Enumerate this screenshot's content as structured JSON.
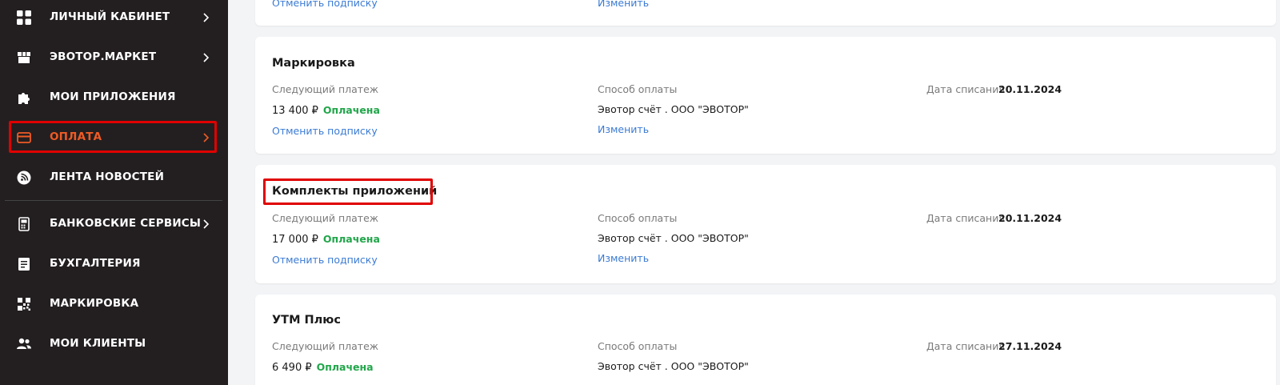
{
  "sidebar": {
    "items": [
      {
        "label": "ЛИЧНЫЙ КАБИНЕТ",
        "icon": "grid-icon",
        "chevron": true
      },
      {
        "label": "ЭВОТОР.МАРКЕТ",
        "icon": "store-icon",
        "chevron": true
      },
      {
        "label": "МОИ ПРИЛОЖЕНИЯ",
        "icon": "puzzle-icon",
        "chevron": false
      },
      {
        "label": "ОПЛАТА",
        "icon": "card-icon",
        "chevron": true,
        "active": true
      },
      {
        "label": "ЛЕНТА НОВОСТЕЙ",
        "icon": "feed-icon",
        "chevron": false
      },
      {
        "label": "БАНКОВСКИЕ СЕРВИСЫ",
        "icon": "bank-terminal-icon",
        "chevron": true
      },
      {
        "label": "БУХГАЛТЕРИЯ",
        "icon": "receipt-icon",
        "chevron": false
      },
      {
        "label": "МАРКИРОВКА",
        "icon": "qr-code-icon",
        "chevron": false
      },
      {
        "label": "МОИ КЛИЕНТЫ",
        "icon": "users-icon",
        "chevron": false
      }
    ],
    "colors": {
      "background": "#231f20",
      "active": "#ef5b25",
      "highlight": "#e00000"
    }
  },
  "top_card": {
    "cancel_link": "Отменить подписку",
    "change_link": "Изменить"
  },
  "cards": [
    {
      "title": "Маркировка",
      "next_payment_label": "Следующий платеж",
      "amount": "13 400 ₽",
      "status": "Оплачена",
      "method_label": "Способ оплаты",
      "method": "Эвотор счёт . ООО \"ЭВОТОР\"",
      "date_label": "Дата списания",
      "date": "20.11.2024",
      "cancel_link": "Отменить подписку",
      "change_link": "Изменить"
    },
    {
      "title": "Комплекты приложений",
      "next_payment_label": "Следующий платеж",
      "amount": "17 000 ₽",
      "status": "Оплачена",
      "method_label": "Способ оплаты",
      "method": "Эвотор счёт . ООО \"ЭВОТОР\"",
      "date_label": "Дата списания",
      "date": "20.11.2024",
      "cancel_link": "Отменить подписку",
      "change_link": "Изменить"
    },
    {
      "title": "УТМ Плюс",
      "next_payment_label": "Следующий платеж",
      "amount": "6 490 ₽",
      "status": "Оплачена",
      "method_label": "Способ оплаты",
      "method": "Эвотор счёт . ООО \"ЭВОТОР\"",
      "date_label": "Дата списания",
      "date": "27.11.2024"
    }
  ],
  "colors": {
    "paid": "#21a64a",
    "link": "#3b7bd4"
  }
}
